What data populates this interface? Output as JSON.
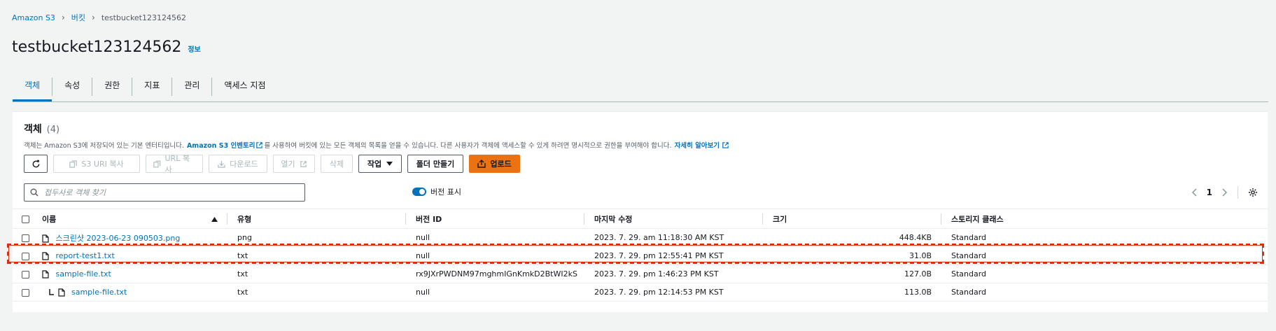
{
  "breadcrumb": {
    "root": "Amazon S3",
    "buckets": "버킷",
    "current": "testbucket123124562"
  },
  "header": {
    "title": "testbucket123124562",
    "info": "정보"
  },
  "tabs": [
    {
      "label": "객체",
      "active": true
    },
    {
      "label": "속성"
    },
    {
      "label": "권한"
    },
    {
      "label": "지표"
    },
    {
      "label": "관리"
    },
    {
      "label": "액세스 지점"
    }
  ],
  "objects": {
    "heading": "객체",
    "count": "(4)",
    "description_pre": "객체는 Amazon S3에 저장되어 있는 기본 엔터티입니다.",
    "inventory_link": "Amazon S3 인벤토리",
    "description_mid": "를 사용하여 버킷에 있는 모든 객체의 목록을 얻을 수 있습니다. 다른 사용자가 객체에 액세스할 수 있게 하려면 명시적으로 권한을 부여해야 합니다.",
    "learn_more": "자세히 알아보기"
  },
  "toolbar": {
    "copy_s3_uri": "S3 URI 복사",
    "copy_url": "URL 복사",
    "download": "다운로드",
    "open": "열기",
    "delete": "삭제",
    "actions": "작업",
    "create_folder": "폴더 만들기",
    "upload": "업로드"
  },
  "search": {
    "placeholder": "접두사로 객체 찾기"
  },
  "versions_toggle": {
    "label": "버전 표시",
    "on": true
  },
  "pager": {
    "page": "1"
  },
  "table": {
    "columns": [
      "이름",
      "유형",
      "버전 ID",
      "마지막 수정",
      "크기",
      "스토리지 클래스"
    ],
    "rows": [
      {
        "name": "스크린샷 2023-06-23 090503.png",
        "type": "png",
        "version": "null",
        "modified": "2023. 7. 29. am 11:18:30 AM KST",
        "size": "448.4KB",
        "storage": "Standard"
      },
      {
        "name": "report-test1.txt",
        "type": "txt",
        "version": "null",
        "modified": "2023. 7. 29. pm 12:55:41 PM KST",
        "size": "31.0B",
        "storage": "Standard"
      },
      {
        "name": "sample-file.txt",
        "type": "txt",
        "version": "rx9JXrPWDNM97mghmIGnKmkD2BtWI2kS",
        "modified": "2023. 7. 29. pm 1:46:23 PM KST",
        "size": "127.0B",
        "storage": "Standard"
      },
      {
        "name": "sample-file.txt",
        "type": "txt",
        "version": "null",
        "modified": "2023. 7. 29. pm 12:14:53 PM KST",
        "size": "113.0B",
        "storage": "Standard"
      }
    ]
  },
  "colors": {
    "link": "#0073bb",
    "primary": "#ec7211",
    "highlight": "#d13212"
  }
}
